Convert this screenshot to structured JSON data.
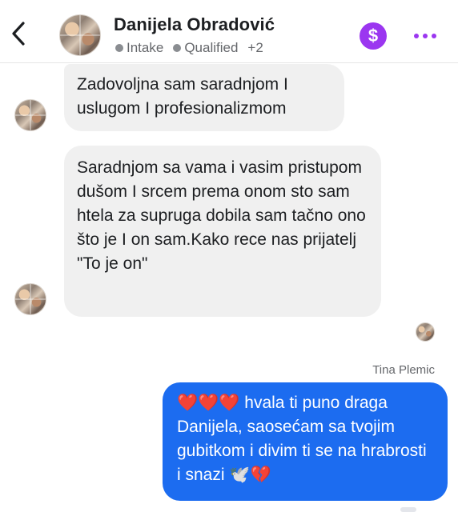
{
  "header": {
    "name": "Danijela Obradović",
    "tags": [
      "Intake",
      "Qualified"
    ],
    "more_tags": "+2",
    "payment_symbol": "$"
  },
  "messages": [
    {
      "direction": "incoming",
      "text": "Zadovoljna sam saradnjom I uslugom I profesionalizmom"
    },
    {
      "direction": "incoming",
      "text": "Saradnjom sa vama i vasim pristupom dušom I srcem prema onom sto sam htela za supruga dobila sam tačno ono što je I on sam.Kako rece nas prijatelj \"To je on\""
    },
    {
      "direction": "outgoing",
      "sender": "Tina Plemic",
      "text": "❤️❤️❤️ hvala ti puno draga Danijela, saosećam sa tvojim gubitkom i divim ti se na hrabrosti i snazi 🕊️💔"
    }
  ],
  "colors": {
    "accent": "#9b36f0",
    "outgoing_bubble": "#1c6cf0",
    "incoming_bubble": "#f0f0f0"
  },
  "icons": [
    "back-arrow-icon",
    "payment-dollar-icon",
    "more-options-icon"
  ]
}
